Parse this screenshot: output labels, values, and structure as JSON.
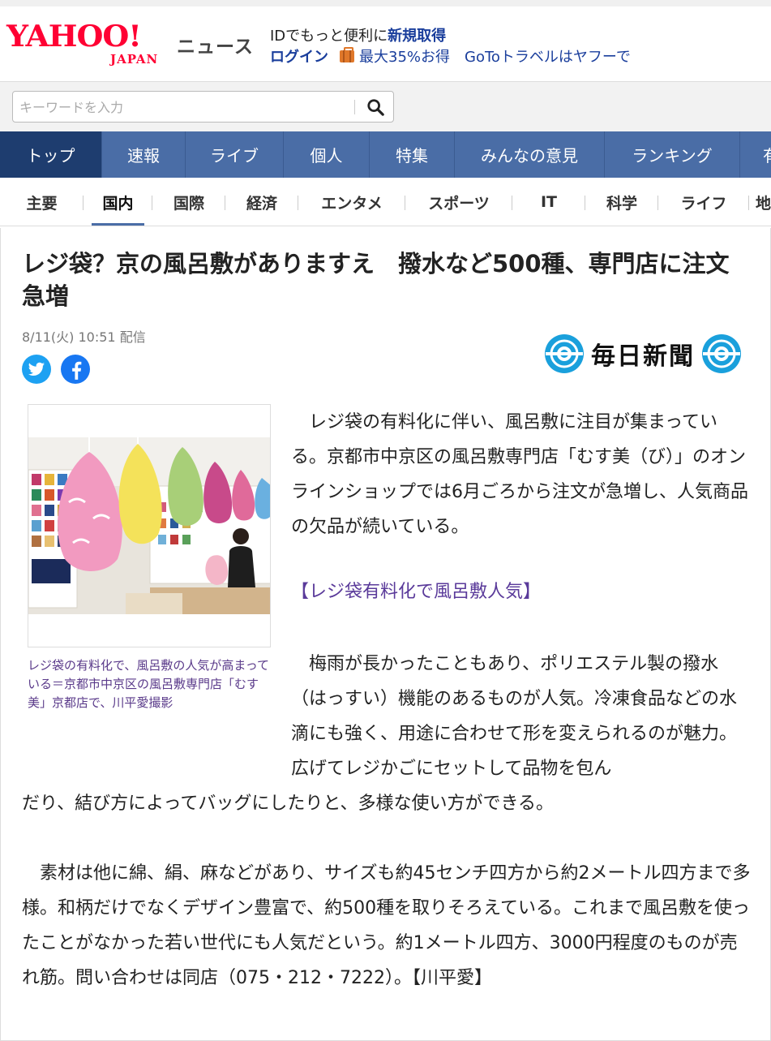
{
  "header": {
    "logo_text": "YAHOO!",
    "logo_sub": "JAPAN",
    "service_name": "ニュース",
    "promo_line1_prefix": "IDでもっと便利に",
    "promo_line1_link": "新規取得",
    "login_label": "ログイン",
    "deal_label": "最大35%お得",
    "goto_label": "GoToトラベルはヤフーで"
  },
  "search": {
    "placeholder": "キーワードを入力",
    "icon": "search-icon"
  },
  "main_nav": [
    {
      "label": "トップ",
      "active": true
    },
    {
      "label": "速報"
    },
    {
      "label": "ライブ"
    },
    {
      "label": "個人"
    },
    {
      "label": "特集"
    },
    {
      "label": "みんなの意見"
    },
    {
      "label": "ランキング"
    },
    {
      "label": "有"
    }
  ],
  "sub_nav": [
    {
      "label": "主要"
    },
    {
      "label": "国内",
      "active": true
    },
    {
      "label": "国際"
    },
    {
      "label": "経済"
    },
    {
      "label": "エンタメ"
    },
    {
      "label": "スポーツ"
    },
    {
      "label": "IT"
    },
    {
      "label": "科学"
    },
    {
      "label": "ライフ"
    },
    {
      "label": "地"
    }
  ],
  "article": {
    "headline": "レジ袋？京の風呂敷がありますえ　撥水など500種、専門店に注文急増",
    "date": "8/11(火) 10:51 配信",
    "source": "毎日新聞",
    "photo_caption": "レジ袋の有料化で、風呂敷の人気が高まっている＝京都市中京区の風呂敷専門店「むす美」京都店で、川平愛撮影",
    "p1": "レジ袋の有料化に伴い、風呂敷に注目が集まっている。京都市中京区の風呂敷専門店「むす美（び）」のオンラインショップでは6月ごろから注文が急増し、人気商品の欠品が続いている。",
    "related_link": "【レジ袋有料化で風呂敷人気】",
    "p2a": "梅雨が長かったこともあり、ポリエステル製の撥水（はっすい）機能のあるものが人気。冷凍食品などの水滴にも強く、用途に合わせて形を変えられるのが魅力。広げてレジかごにセットして品物を包ん",
    "p2b": "だり、結び方によってバッグにしたりと、多様な使い方ができる。",
    "p3": "素材は他に綿、絹、麻などがあり、サイズも約45センチ四方から約2メートル四方まで多様。和柄だけでなくデザイン豊富で、約500種を取りそろえている。これまで風呂敷を使ったことがなかった若い世代にも人気だという。約1メートル四方、3000円程度のものが売れ筋。問い合わせは同店（075・212・7222）。【川平愛】"
  },
  "colors": {
    "brand_red": "#ff0033",
    "nav_blue": "#4a6da6",
    "nav_active": "#1e3d6f",
    "link_purple": "#5a3a9a"
  }
}
